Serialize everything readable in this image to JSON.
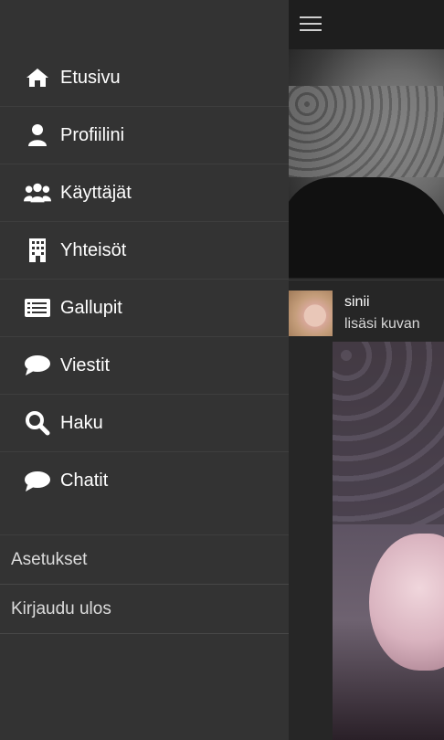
{
  "nav": {
    "items": [
      {
        "label": "Etusivu",
        "icon": "home-icon"
      },
      {
        "label": "Profiilini",
        "icon": "user-icon"
      },
      {
        "label": "Käyttäjät",
        "icon": "users-icon"
      },
      {
        "label": "Yhteisöt",
        "icon": "building-icon"
      },
      {
        "label": "Gallupit",
        "icon": "poll-list-icon"
      },
      {
        "label": "Viestit",
        "icon": "speech-bubble-icon"
      },
      {
        "label": "Haku",
        "icon": "search-icon"
      },
      {
        "label": "Chatit",
        "icon": "chat-bubble-icon"
      }
    ]
  },
  "secondary": {
    "settings": "Asetukset",
    "logout": "Kirjaudu ulos"
  },
  "feed": {
    "post": {
      "username": "sinii",
      "action": "lisäsi kuvan"
    }
  },
  "colors": {
    "drawer_bg": "#333333",
    "topbar_bg": "#1e1e1e",
    "text": "#ffffff"
  }
}
